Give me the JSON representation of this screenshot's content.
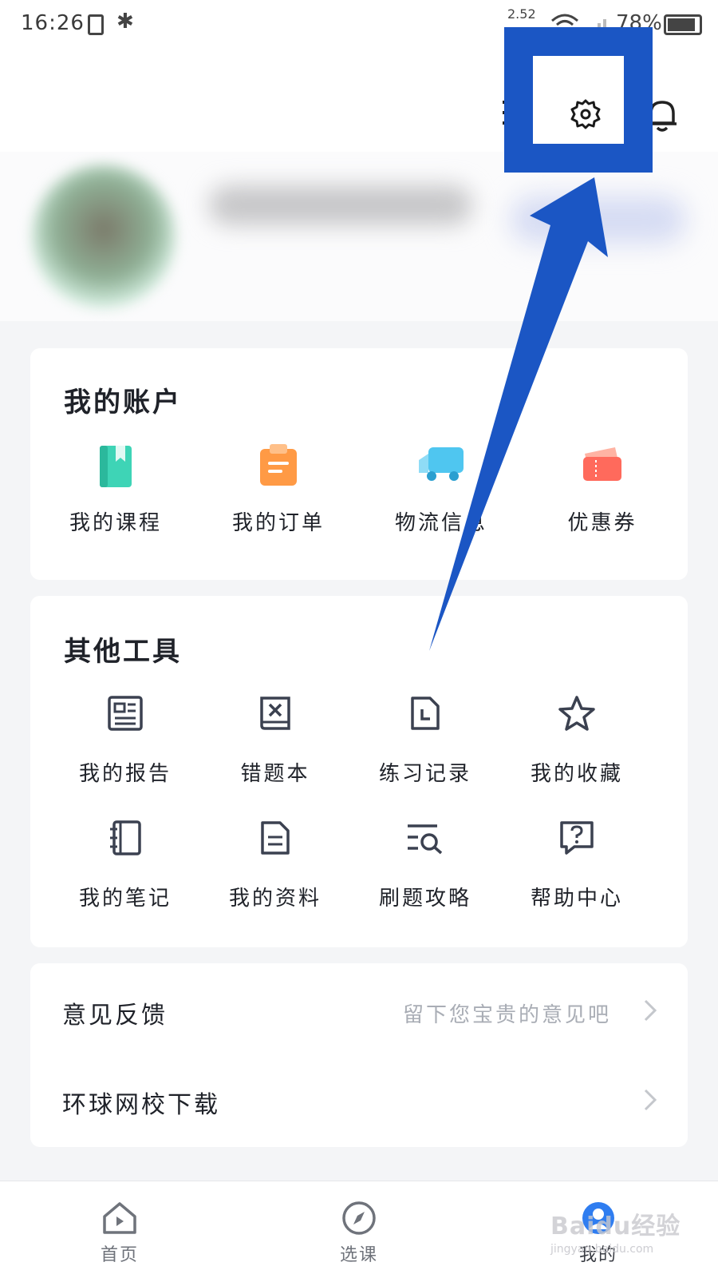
{
  "status_bar": {
    "time": "16:26",
    "net_speed": "2.52",
    "battery": "78%"
  },
  "account": {
    "title": "我的账户",
    "items": [
      {
        "label": "我的课程",
        "icon": "book-icon",
        "color": "#3ed4b6"
      },
      {
        "label": "我的订单",
        "icon": "order-icon",
        "color": "#ff9a45"
      },
      {
        "label": "物流信息",
        "icon": "truck-icon",
        "color": "#4fc6f0"
      },
      {
        "label": "优惠券",
        "icon": "coupon-icon",
        "color": "#ff6a5c"
      }
    ]
  },
  "tools": {
    "title": "其他工具",
    "items": [
      {
        "label": "我的报告",
        "icon": "report-icon"
      },
      {
        "label": "错题本",
        "icon": "wrong-book-icon"
      },
      {
        "label": "练习记录",
        "icon": "practice-record-icon"
      },
      {
        "label": "我的收藏",
        "icon": "star-icon"
      },
      {
        "label": "我的笔记",
        "icon": "notebook-icon"
      },
      {
        "label": "我的资料",
        "icon": "document-icon"
      },
      {
        "label": "刷题攻略",
        "icon": "search-list-icon"
      },
      {
        "label": "帮助中心",
        "icon": "help-icon"
      }
    ]
  },
  "misc": {
    "feedback_label": "意见反馈",
    "feedback_hint": "留下您宝贵的意见吧",
    "download_label": "环球网校下载"
  },
  "tabbar": {
    "home": "首页",
    "courses": "选课",
    "mine": "我的"
  },
  "watermark": {
    "main": "Baidu经验",
    "sub": "jingyan.baidu.com"
  },
  "colors": {
    "annotation": "#1b56c4",
    "icon_stroke": "#3b4150"
  }
}
